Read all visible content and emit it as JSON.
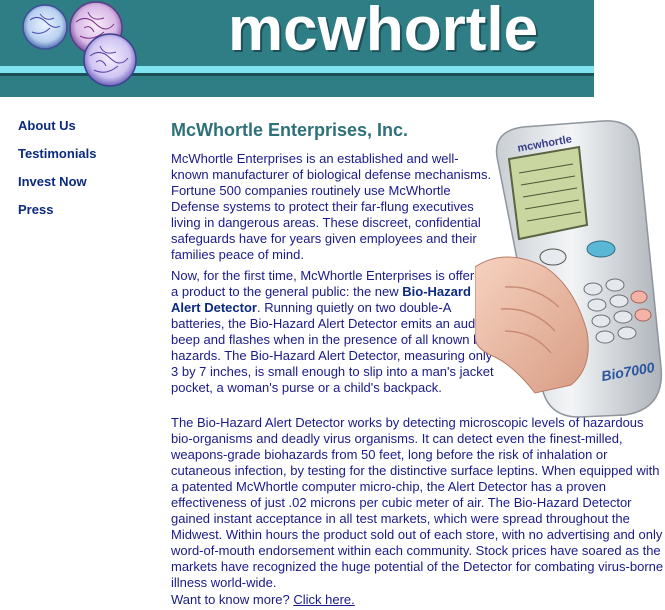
{
  "header": {
    "brand_text": "mcwhortle",
    "logo_icon": "microbe-cells-icon"
  },
  "nav": {
    "items": [
      {
        "label": "About Us"
      },
      {
        "label": "Testimonials"
      },
      {
        "label": "Invest Now"
      },
      {
        "label": "Press"
      }
    ]
  },
  "main": {
    "title": "McWhortle Enterprises, Inc.",
    "p1": "McWhortle Enterprises is an established and well-known manufacturer of biological defense mechanisms. Fortune 500 companies routinely use McWhortle Defense systems to protect their far-flung executives living in dangerous areas. These discreet, confidential safeguards have for years given employees and their families peace of mind.",
    "p2_before": "Now, for the first time, McWhortle Enterprises is offering a product to the general public: the new ",
    "p2_product": "Bio-Hazard Alert Detector",
    "p2_after": ". Running quietly on two double-A batteries, the Bio-Hazard Alert Detector emits an audible beep and flashes when in the presence of all known bio-hazards. The Bio-Hazard Alert Detector, measuring only 3 by 7 inches, is small enough to slip into a man's jacket pocket, a woman's purse or a child's backpack.",
    "p3": "The Bio-Hazard Alert Detector works by detecting microscopic levels of hazardous bio-organisms and deadly virus organisms. It can detect even the finest-milled, weapons-grade biohazards from 50 feet, long before the risk of inhalation or cutaneous infection, by testing for the distinctive surface leptins. When equipped with a patented McWhortle computer micro-chip, the Alert Detector has a proven effectiveness of just .02 microns per cubic meter of air. The Bio-Hazard Detector gained instant acceptance in all test markets, which were spread throughout the Midwest. Within hours the product sold out of each store, with no advertising and only word-of-mouth endorsement within each community. Stock prices have soared as the markets have recognized the huge potential of the Detector for combating virus-borne illness world-wide.",
    "p4_prefix": "Want to know more? ",
    "p4_link": "Click here."
  },
  "device": {
    "brand_label": "mcwhortle",
    "model_label": "Bio7000",
    "image_icon": "handheld-detector-icon"
  },
  "colors": {
    "banner": "#2f7e86",
    "banner_stripe": "#7fe4f0",
    "nav_link": "#0b2a80",
    "title": "#2e7178",
    "body_text": "#1a1a8a"
  }
}
